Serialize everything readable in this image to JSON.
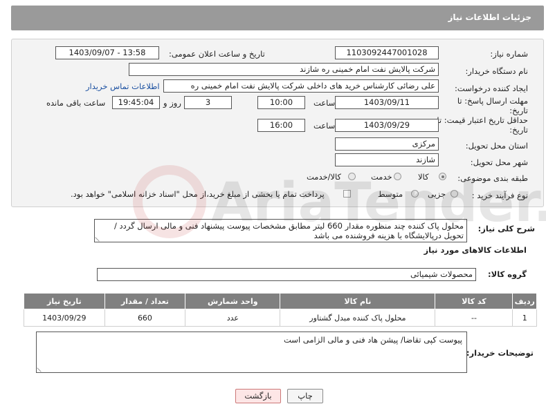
{
  "header": {
    "title": "جزئیات اطلاعات نیاز"
  },
  "form": {
    "need_number": {
      "label": "شماره نیاز:",
      "value": "1103092447001028"
    },
    "announce": {
      "label": "تاریخ و ساعت اعلان عمومی:",
      "value": "1403/09/07 - 13:58"
    },
    "buyer_org": {
      "label": "نام دستگاه خریدار:",
      "value": "شرکت پالایش نفت امام خمینی  ره  شازند"
    },
    "creator": {
      "label": "ایجاد کننده درخواست:",
      "value": "علی  رضائی کارشناس خرید های داخلی  شرکت پالایش نفت امام خمینی  ره",
      "contact_link": "اطلاعات تماس خریدار"
    },
    "deadline": {
      "label_line1": "مهلت ارسال پاسخ: تا",
      "label_line2": "تاریخ:",
      "date": "1403/09/11",
      "time_label": "ساعت",
      "time": "10:00",
      "days": "3",
      "days_label": "روز و",
      "remaining": "19:45:04",
      "remaining_label": "ساعت باقی مانده"
    },
    "validity": {
      "label_line1": "حداقل تاریخ اعتبار قیمت: تا",
      "label_line2": "تاریخ:",
      "date": "1403/09/29",
      "time_label": "ساعت",
      "time": "16:00"
    },
    "province": {
      "label": "استان محل تحویل:",
      "value": "مرکزی"
    },
    "city": {
      "label": "شهر محل تحویل:",
      "value": "شازند"
    },
    "category": {
      "label": "طبقه بندی موضوعی:",
      "options": [
        "کالا",
        "خدمت",
        "کالا/خدمت"
      ],
      "selected": "کالا"
    },
    "process": {
      "label": "نوع فرآیند خرید :",
      "options": [
        "جزیی",
        "متوسط"
      ],
      "selected": "جزیی",
      "payment_text": "پرداخت تمام یا بخشی از مبلغ خرید،از محل \"اسناد خزانه اسلامی\" خواهد بود."
    }
  },
  "summary": {
    "label": "شرح کلی نیاز:",
    "text": "محلول پاک کننده چند منظوره   مقدار 660 لیتر  مطابق مشخصات پیوست پیشنهاد فنی و مالی ارسال گردد / تحویل درپالایشگاه با هزینه فروشنده می باشد"
  },
  "goods": {
    "section_title": "اطلاعات کالاهای مورد نیاز",
    "group_label": "گروه کالا:",
    "group_value": "محصولات شیمیائی",
    "columns": [
      "ردیف",
      "کد کالا",
      "نام کالا",
      "واحد شمارش",
      "تعداد / مقدار",
      "تاریخ نیاز"
    ],
    "rows": [
      {
        "row": "1",
        "code": "--",
        "name": "محلول پاک کننده مبدل گشتاور",
        "unit": "عدد",
        "qty": "660",
        "date": "1403/09/29"
      }
    ]
  },
  "buyer_notes": {
    "label": "توضیحات خریدار:",
    "text": "پیوست کپی تقاضا/  پیشن هاد فنی و مالی الزامی است"
  },
  "buttons": {
    "print": "چاپ",
    "back": "بازگشت"
  },
  "watermark": {
    "text": "AriaTender.net"
  }
}
